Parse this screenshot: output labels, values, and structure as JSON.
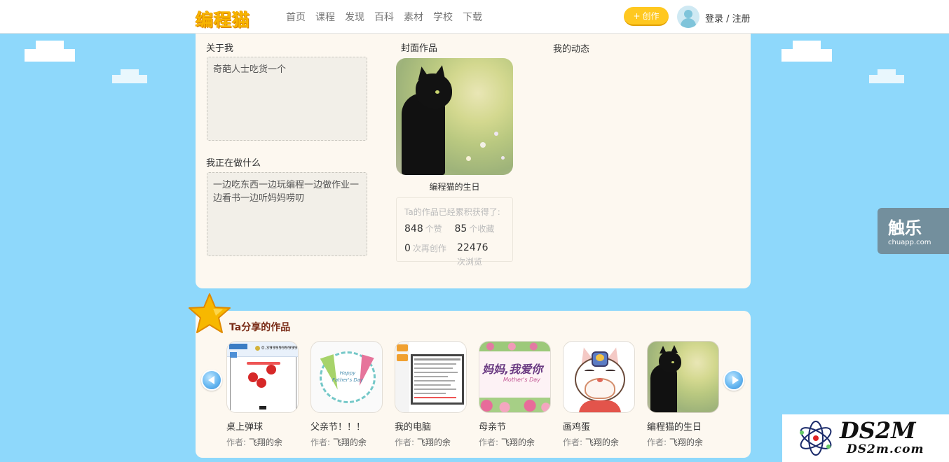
{
  "header": {
    "logo": "编程猫",
    "nav": [
      "首页",
      "课程",
      "发现",
      "百科",
      "素材",
      "学校",
      "下载"
    ],
    "create_label": "创作",
    "create_icon": "plus-icon",
    "login_label": "登录 / 注册"
  },
  "profile": {
    "about_label": "关于我",
    "about_text": "奇葩人士吃货一个",
    "doing_label": "我正在做什么",
    "doing_text": "一边吃东西一边玩编程一边做作业一边看书一边听妈妈唠叨",
    "cover_label": "封面作品",
    "cover_caption": "编程猫的生日",
    "activity_label": "我的动态",
    "stats_title": "Ta的作品已经累积获得了:",
    "stats": [
      {
        "value": "848",
        "unit": "个赞"
      },
      {
        "value": "85",
        "unit": "个收藏"
      },
      {
        "value": "0",
        "unit": "次再创作"
      },
      {
        "value": "22476",
        "unit": "次浏览"
      }
    ]
  },
  "works": {
    "title": "Ta分享的作品",
    "author_prefix": "作者:",
    "items": [
      {
        "title": "桌上弹球",
        "author": "飞翔的余"
      },
      {
        "title": "父亲节！！！",
        "author": "飞翔的余"
      },
      {
        "title": "我的电脑",
        "author": "飞翔的余"
      },
      {
        "title": "母亲节",
        "author": "飞翔的余"
      },
      {
        "title": "画鸡蛋",
        "author": "飞翔的余"
      },
      {
        "title": "编程猫的生日",
        "author": "飞翔的余"
      }
    ],
    "thumb_texts": {
      "pinball_score": "0.3999999999",
      "fathers_day": "Happy Father's Day",
      "mothers_day": "妈妈,我爱你",
      "mothers_day_sub": "Mother's Day"
    }
  },
  "watermarks": {
    "chuapp_big": "触乐",
    "chuapp_small": "chuapp.com",
    "ds2m_big": "DS2M",
    "ds2m_small": "DS2m.com"
  },
  "colors": {
    "sky": "#8ed8fb",
    "card": "#fdf8f0",
    "accent_yellow": "#ffc820",
    "works_title": "#7a2c17"
  }
}
